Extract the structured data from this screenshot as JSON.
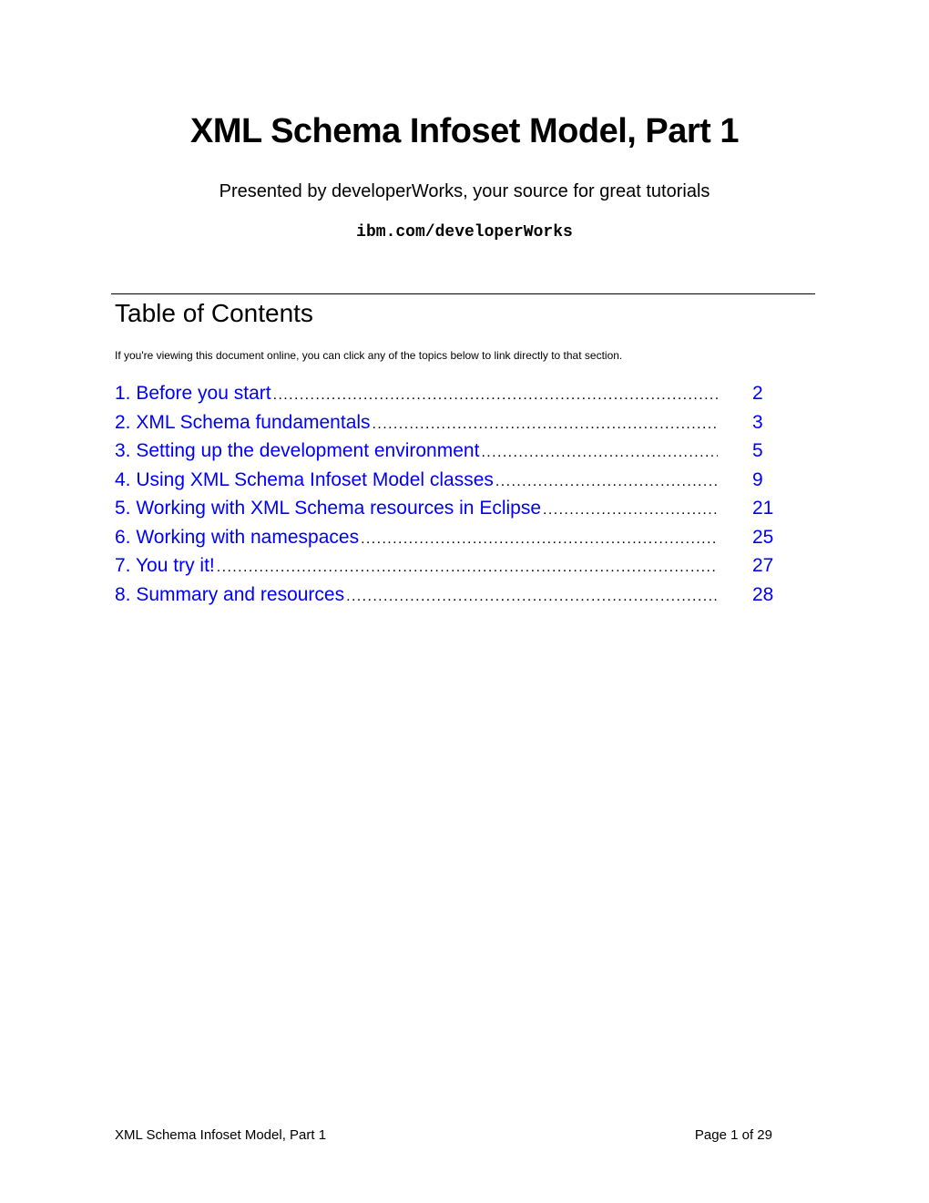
{
  "document": {
    "title": "XML Schema Infoset Model, Part 1",
    "subtitle": "Presented by developerWorks, your source for great tutorials",
    "site": "ibm.com/developerWorks"
  },
  "toc": {
    "heading": "Table of Contents",
    "note": "If you're viewing this document online, you can click any of the topics below to link directly to that section.",
    "link_color": "#0000ff",
    "leader": "..................................................................................................................................",
    "items": [
      {
        "label": "1. Before you start",
        "page": "2"
      },
      {
        "label": "2. XML Schema fundamentals",
        "page": "3"
      },
      {
        "label": "3. Setting up the development environment",
        "page": "5"
      },
      {
        "label": "4. Using XML Schema Infoset Model classes",
        "page": "9"
      },
      {
        "label": "5. Working with XML Schema resources in Eclipse",
        "page": "21"
      },
      {
        "label": "6. Working with namespaces",
        "page": "25"
      },
      {
        "label": "7. You try it!",
        "page": "27"
      },
      {
        "label": "8. Summary and resources",
        "page": "28"
      }
    ]
  },
  "footer": {
    "left": "XML Schema Infoset Model, Part 1",
    "right": "Page 1 of 29"
  }
}
